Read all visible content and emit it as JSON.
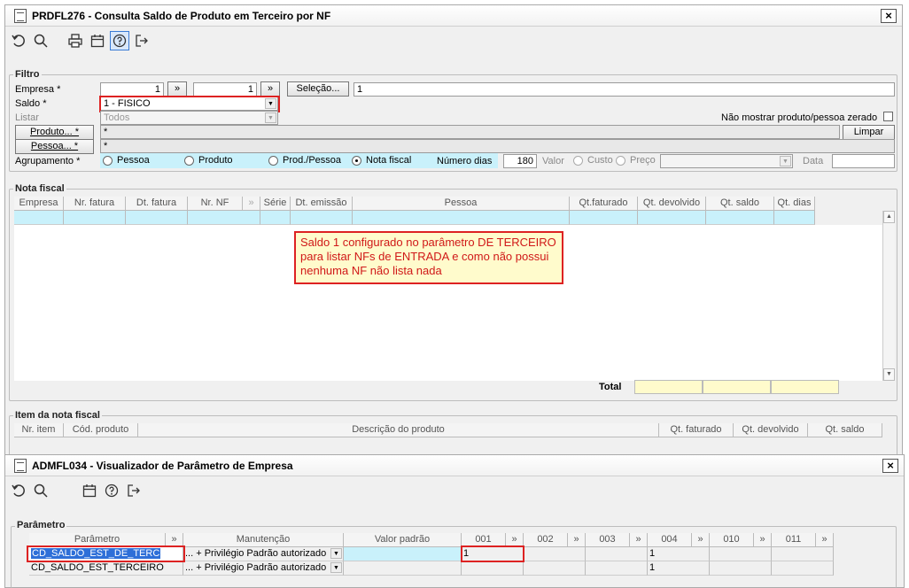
{
  "main_window": {
    "title": "PRDFL276 - Consulta Saldo de Produto em Terceiro por NF",
    "close_label": "×",
    "filtro": {
      "legend": "Filtro",
      "empresa_label": "Empresa *",
      "empresa_from": "1",
      "empresa_to": "1",
      "range_button": "»",
      "selecao_button": "Seleção...",
      "selecao_value": "1",
      "saldo_label": "Saldo *",
      "saldo_value": "1 - FISICO",
      "listar_label": "Listar",
      "listar_value": "Todos",
      "nao_mostrar_label": "Não mostrar produto/pessoa zerado",
      "produto_button": "Produto... *",
      "produto_value": "*",
      "limpar_button": "Limpar",
      "pessoa_button": "Pessoa... *",
      "pessoa_value": "*",
      "agrupamento_label": "Agrupamento *",
      "agrupamento_options": [
        "Pessoa",
        "Produto",
        "Prod./Pessoa",
        "Nota fiscal"
      ],
      "agrupamento_selected": "Nota fiscal",
      "numero_dias_label": "Número dias",
      "numero_dias_value": "180",
      "valor_label": "Valor",
      "valor_options": [
        "Custo",
        "Preço"
      ],
      "data_label": "Data",
      "data_value": ""
    },
    "nota_fiscal": {
      "legend": "Nota fiscal",
      "columns": [
        "Empresa",
        "Nr. fatura",
        "Dt. fatura",
        "Nr. NF",
        "»",
        "Série",
        "Dt. emissão",
        "Pessoa",
        "Qt.faturado",
        "Qt. devolvido",
        "Qt. saldo",
        "Qt. dias"
      ],
      "total_label": "Total"
    },
    "item_nota": {
      "legend": "Item da nota fiscal",
      "columns": [
        "Nr. item",
        "Cód. produto",
        "Descrição do produto",
        "Qt. faturado",
        "Qt. devolvido",
        "Qt. saldo"
      ]
    },
    "annotation": "Saldo 1 configurado no parâmetro DE TERCEIRO para listar NFs de ENTRADA e como não possui nenhuma NF não lista nada"
  },
  "param_window": {
    "title": "ADMFL034 - Visualizador de Parâmetro de Empresa",
    "close_label": "×",
    "legend": "Parâmetro",
    "columns": {
      "parametro": "Parâmetro",
      "manutencao": "Manutenção",
      "valor_padrao": "Valor padrão",
      "c001": "001",
      "c002": "002",
      "c003": "003",
      "c004": "004",
      "c010": "010",
      "c011": "011",
      "more": "»"
    },
    "rows": [
      {
        "parametro": "CD_SALDO_EST_DE_TERC",
        "manutencao": "... + Privilégio Padrão autorizado",
        "valor_padrao": "",
        "c001": "1",
        "c002": "",
        "c003": "",
        "c004": "1",
        "c010": "",
        "c011": ""
      },
      {
        "parametro": "CD_SALDO_EST_TERCEIRO",
        "manutencao": "... + Privilégio Padrão autorizado",
        "valor_padrao": "",
        "c001": "",
        "c002": "",
        "c003": "",
        "c004": "1",
        "c010": "",
        "c011": ""
      }
    ]
  }
}
